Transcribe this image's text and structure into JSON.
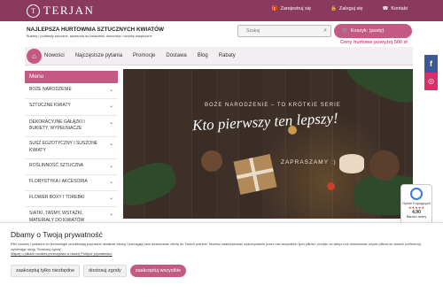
{
  "header": {
    "logo_letter": "T",
    "logo_word": "TERJAN",
    "links": [
      {
        "icon": "gift-icon",
        "glyph": "🎁",
        "label": "Zarejestruj się"
      },
      {
        "icon": "lock-icon",
        "glyph": "🔒",
        "label": "Zaloguj się"
      },
      {
        "icon": "phone-icon",
        "glyph": "☎",
        "label": "Kontakt"
      }
    ],
    "tagline": "NAJLEPSZA HURTOWNIA SZTUCZNYCH KWIATÓW",
    "subtagline": "Bukiety i podkłady sztuczne, akcesoria do kwiaciarni, dekoracje i ozdoby świąteczne",
    "search_placeholder": "Szukaj",
    "cart_label": "Koszyk: (pusty)",
    "threshold": "Ceny hurtowe powyżej 500 zł"
  },
  "nav": {
    "items": [
      "Nowości",
      "Najczęstsze pytania",
      "Promocje",
      "Dostawa",
      "Blog",
      "Rabaty"
    ]
  },
  "sidebar": {
    "title": "Menu",
    "categories": [
      "BOŻE NARODZENIE",
      "SZTUCZNE KWIATY",
      "DEKORACYJNE GAŁĄZKI I BUKIETY, WYPEŁNIACZE",
      "SUSZ EGZOTYCZNY I SUSZONE KWIATY",
      "ROŚLINNOŚĆ SZTUCZNA",
      "FLORYSTYKA I AKCESORIA",
      "FLOWER BOXY I TOREBKI",
      "SIATKI, TAŚMY, WSTĄŻKI, MATERIAŁY DO KWIATÓW"
    ]
  },
  "hero": {
    "small_heading": "BOŻE NARODZENIE – TO KRÓTKIE SERIE",
    "script_heading": "Kto pierwszy ten lepszy!",
    "invite": "ZAPRASZAMY :)"
  },
  "social": {
    "facebook": "f",
    "instagram": "◎"
  },
  "rating_badge": {
    "name": "Opinie Kupujących",
    "stars": "★★★★★",
    "score": "4,90",
    "verdict": "Bardzo dobry"
  },
  "cookie": {
    "title": "Dbamy o Twoją prywatność",
    "text": "Pliki cookies i podobne im technologie umożliwiają poprawne działanie strony i pomagają nam dostosować ofertę do Twoich potrzeb. Możesz zaakceptować wykorzystanie przez nas wszystkich tych plików i przejść do sklepu lub dostosować użycie plików do swoich preferencji, wybierając opcję \"Dostosuj zgody\".",
    "link": "Więcej o plikach cookies przeczytasz w naszej Polityce prywatności.",
    "buttons": {
      "necessary": "zaakceptuj tylko niezbędne",
      "customize": "dostosuj zgody",
      "all": "zaakceptuj wszystkie"
    }
  },
  "colors": {
    "brand": "#8a3a5c",
    "accent": "#c45a84"
  }
}
